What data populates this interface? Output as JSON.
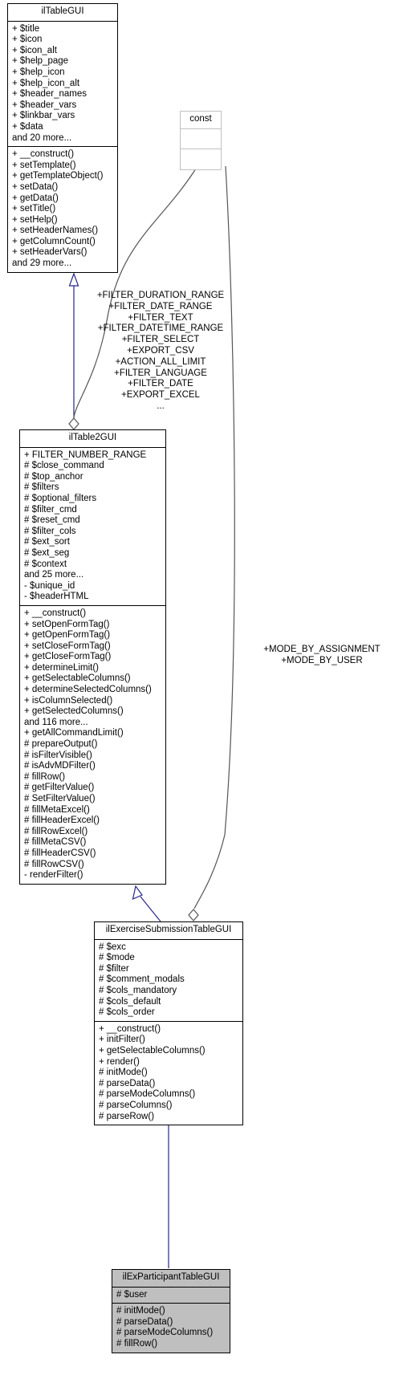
{
  "diagram": {
    "type": "uml-class-diagram",
    "title": "ilExParticipantTableGUI inheritance diagram"
  },
  "classes": [
    {
      "id": "ilTableGUI",
      "name": "ilTableGUI",
      "style": "normal",
      "attributes": [
        "+ $title",
        "+ $icon",
        "+ $icon_alt",
        "+ $help_page",
        "+ $help_icon",
        "+ $help_icon_alt",
        "+ $header_names",
        "+ $header_vars",
        "+ $linkbar_vars",
        "+ $data",
        "and 20 more..."
      ],
      "methods": [
        "+ __construct()",
        "+ setTemplate()",
        "+ getTemplateObject()",
        "+ setData()",
        "+ getData()",
        "+ setTitle()",
        "+ setHelp()",
        "+ setHeaderNames()",
        "+ getColumnCount()",
        "+ setHeaderVars()",
        "and 29 more..."
      ]
    },
    {
      "id": "const",
      "name": "const",
      "style": "faded",
      "attributes": [],
      "methods": []
    },
    {
      "id": "ilTable2GUI",
      "name": "ilTable2GUI",
      "style": "normal",
      "attributes": [
        "+ FILTER_NUMBER_RANGE",
        "# $close_command",
        "# $top_anchor",
        "# $filters",
        "# $optional_filters",
        "# $filter_cmd",
        "# $reset_cmd",
        "# $filter_cols",
        "# $ext_sort",
        "# $ext_seg",
        "# $context",
        "and 25 more...",
        "- $unique_id",
        "- $headerHTML"
      ],
      "methods": [
        "+ __construct()",
        "+ setOpenFormTag()",
        "+ getOpenFormTag()",
        "+ setCloseFormTag()",
        "+ getCloseFormTag()",
        "+ determineLimit()",
        "+ getSelectableColumns()",
        "+ determineSelectedColumns()",
        "+ isColumnSelected()",
        "+ getSelectedColumns()",
        "and 116 more...",
        "+ getAllCommandLimit()",
        "# prepareOutput()",
        "# isFilterVisible()",
        "# isAdvMDFilter()",
        "# fillRow()",
        "# getFilterValue()",
        "# SetFilterValue()",
        "# fillMetaExcel()",
        "# fillHeaderExcel()",
        "# fillRowExcel()",
        "# fillMetaCSV()",
        "# fillHeaderCSV()",
        "# fillRowCSV()",
        "- renderFilter()"
      ]
    },
    {
      "id": "ilExerciseSubmissionTableGUI",
      "name": "ilExerciseSubmissionTableGUI",
      "style": "normal",
      "attributes": [
        "# $exc",
        "# $mode",
        "# $filter",
        "# $comment_modals",
        "# $cols_mandatory",
        "# $cols_default",
        "# $cols_order"
      ],
      "methods": [
        "+ __construct()",
        "+ initFilter()",
        "+ getSelectableColumns()",
        "+ render()",
        "# initMode()",
        "# parseData()",
        "# parseModeColumns()",
        "# parseColumns()",
        "# parseRow()"
      ]
    },
    {
      "id": "ilExParticipantTableGUI",
      "name": "ilExParticipantTableGUI",
      "style": "highlight",
      "attributes": [
        "# $user"
      ],
      "methods": [
        "# initMode()",
        "# parseData()",
        "# parseModeColumns()",
        "# fillRow()"
      ]
    }
  ],
  "edge_labels": {
    "const_to_ilTable2GUI": [
      "+FILTER_DURATION_RANGE",
      "+FILTER_DATE_RANGE",
      "+FILTER_TEXT",
      "+FILTER_DATETIME_RANGE",
      "+FILTER_SELECT",
      "+EXPORT_CSV",
      "+ACTION_ALL_LIMIT",
      "+FILTER_LANGUAGE",
      "+FILTER_DATE",
      "+EXPORT_EXCEL",
      "..."
    ],
    "const_to_ilExerciseSubmissionTableGUI": [
      "+MODE_BY_ASSIGNMENT",
      "+MODE_BY_USER"
    ]
  },
  "colors": {
    "border": "#000000",
    "faded_border": "#c0c0c0",
    "highlight_fill": "#bfbfbf",
    "inheritance_line": "#26268c",
    "aggregation_line": "#555555",
    "background": "#ffffff"
  }
}
